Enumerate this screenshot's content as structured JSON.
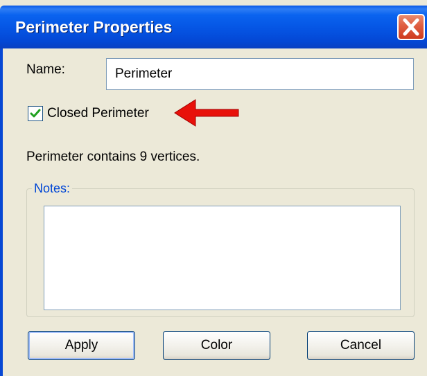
{
  "window": {
    "title": "Perimeter Properties"
  },
  "form": {
    "name_label": "Name:",
    "name_value": "Perimeter",
    "closed_label": "Closed Perimeter",
    "closed_checked": true,
    "vertex_info": "Perimeter contains 9 vertices.",
    "notes_label": "Notes:",
    "notes_value": ""
  },
  "buttons": {
    "apply": "Apply",
    "color": "Color",
    "cancel": "Cancel"
  },
  "icons": {
    "close": "close-icon",
    "check": "checkmark-icon",
    "annotation": "red-arrow-icon"
  },
  "colors": {
    "titlebar": "#0554e3",
    "close_button": "#e06245",
    "group_label": "#0046d5",
    "check": "#21a121",
    "annotation_arrow": "#e8110a"
  }
}
